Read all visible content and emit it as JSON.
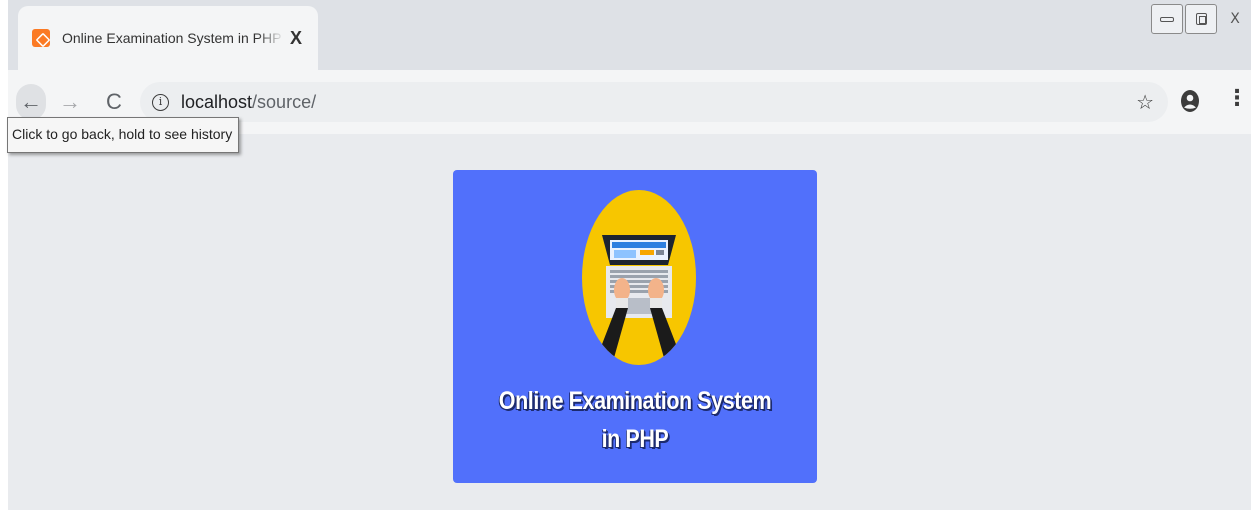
{
  "window": {
    "tab": {
      "title": "Online Examination System in PHP",
      "favicon": "xampp-icon",
      "close_label": "X"
    },
    "controls": {
      "minimize_icon": "minimize-icon",
      "restore_icon": "restore-icon",
      "close_label": "X"
    }
  },
  "toolbar": {
    "back_glyph": "←",
    "forward_glyph": "→",
    "reload_glyph": "C",
    "info_glyph": "i",
    "url_host": "localhost",
    "url_path": "/source/",
    "star_glyph": "☆",
    "menu_glyph": "⋮",
    "tooltip": "Click to go back, hold to see history"
  },
  "page": {
    "hero_title_line1": "Online Examination System",
    "hero_title_line2": "in PHP",
    "colors": {
      "card": "#5170fb",
      "circle": "#f7c600",
      "background": "#e9ebee"
    }
  }
}
